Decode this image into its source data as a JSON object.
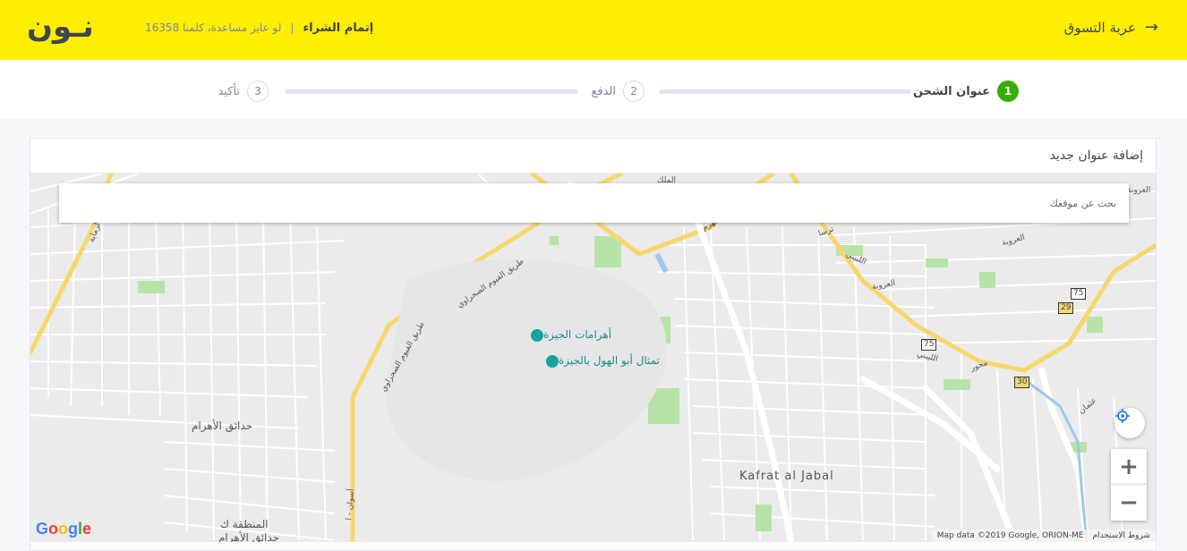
{
  "header": {
    "back_label": "عربة التسوق",
    "logo_text": "نـون",
    "checkout_title": "إتمام الشراء",
    "separator": "|",
    "help_text": "لو عايز مساعدة، كلمنا 16358"
  },
  "steps": [
    {
      "number": "1",
      "label": "عنوان الشحن",
      "active": true
    },
    {
      "number": "2",
      "label": "الدفع",
      "active": false
    },
    {
      "number": "3",
      "label": "تأكيد",
      "active": false
    }
  ],
  "address_card": {
    "title": "إضافة عنوان جديد",
    "search_placeholder": "بحث عن موقعك"
  },
  "map": {
    "labels": {
      "pyramids": "أهرامات الجيزة",
      "sphinx": "تمثال أبو الهول بالجيزة",
      "hadaek": "حدائق الأهرام",
      "kafrat": "Kafrat al Jabal",
      "road_fayoum_1": "طريق الفيوم الصحراوي",
      "road_fayoum_2": "طريق الفيوم الصحراوي",
      "road_haram": "الهرم",
      "road_remaya": "الرماية",
      "road_malek": "الملك",
      "road_orouba_1": "العروبة",
      "road_orouba_2": "العروبة",
      "road_orouba_3": "العروبة",
      "road_labeeni_1": "اللبيني",
      "road_labeeni_2": "اللبيني",
      "road_mehwar": "محور",
      "road_aswan": "أسوان - ا",
      "road_uthman": "عثمان",
      "road_tersa": "ترسا",
      "area_mantaqa": "المنطقة ك",
      "area_hadaek2": "حدائق الأهرام"
    },
    "shields": [
      "75",
      "29",
      "75",
      "30"
    ],
    "google_logo": "Google",
    "footer_data": "Map data ©2019 Google, ORION-ME",
    "footer_terms": "شروط الاستخدام",
    "zoom_in": "+",
    "zoom_out": "−"
  },
  "colors": {
    "brand_yellow": "#feee00",
    "active_green": "#38ae04",
    "text_dark": "#404553",
    "text_muted": "#7e859b"
  }
}
